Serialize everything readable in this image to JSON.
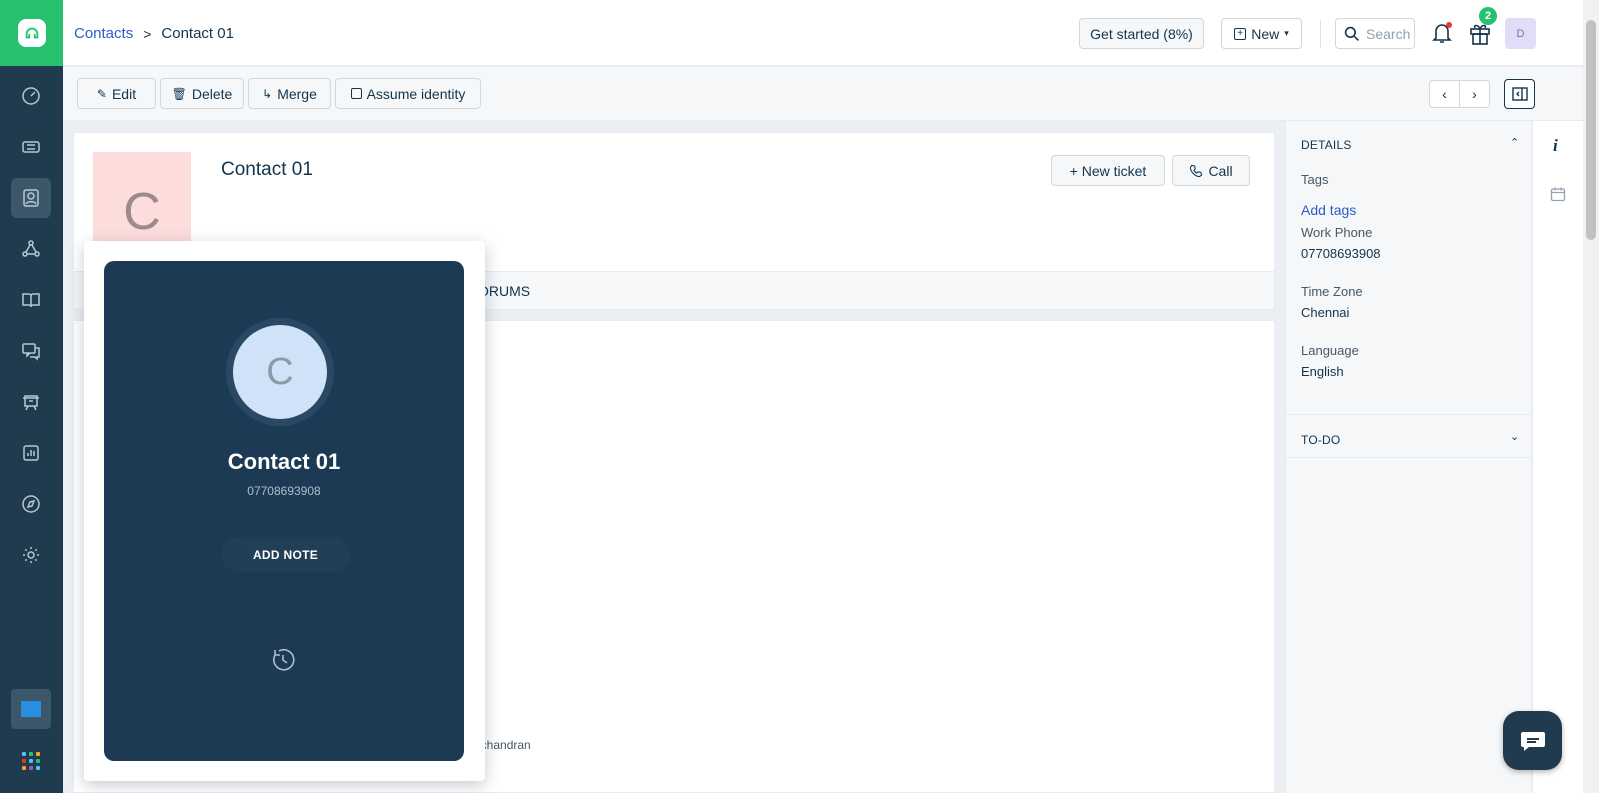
{
  "breadcrumb": {
    "parent": "Contacts",
    "separator": ">",
    "current": "Contact 01"
  },
  "header": {
    "get_started": "Get started (8%)",
    "new_label": "New",
    "search_placeholder": "Search",
    "gift_badge": "2",
    "user_initial": "D"
  },
  "actions": {
    "edit": "Edit",
    "delete": "Delete",
    "merge": "Merge",
    "assume": "Assume identity"
  },
  "contact": {
    "initial": "C",
    "name": "Contact 01",
    "new_ticket": "+  New ticket",
    "call": "Call",
    "tab_visible": "ORUMS",
    "owner_fragment": "vichandran"
  },
  "details": {
    "heading": "DETAILS",
    "tags_label": "Tags",
    "add_tags": "Add tags",
    "work_phone_label": "Work Phone",
    "work_phone": "07708693908",
    "timezone_label": "Time Zone",
    "timezone": "Chennai",
    "language_label": "Language",
    "language": "English",
    "todo_heading": "TO-DO"
  },
  "call_popup": {
    "initial": "C",
    "name": "Contact 01",
    "number": "07708693908",
    "add_note": "ADD NOTE"
  },
  "colors": {
    "brand": "#25c16f",
    "sidebar": "#1f3b4d",
    "link": "#2c5cc5",
    "phone_bg": "#1c3a54"
  }
}
